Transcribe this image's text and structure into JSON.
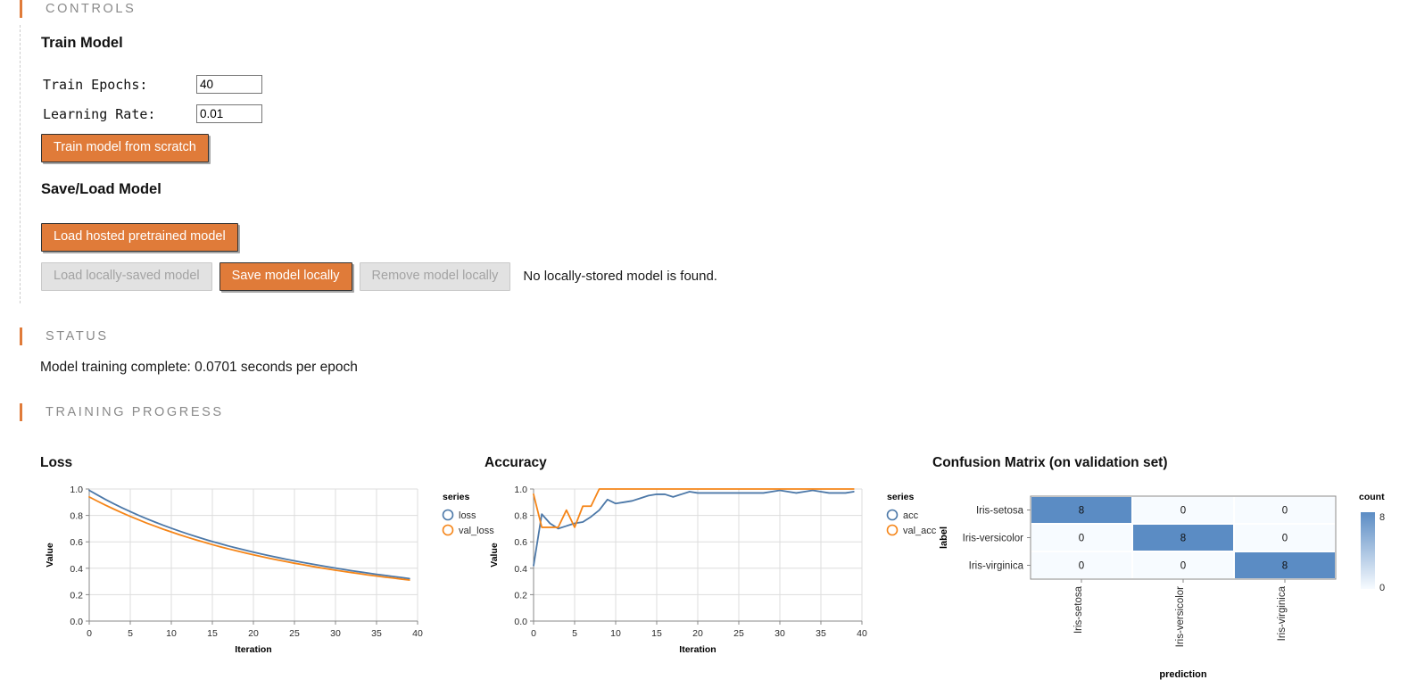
{
  "sections": {
    "controls": "CONTROLS",
    "status": "STATUS",
    "training_progress": "TRAINING PROGRESS"
  },
  "train_model": {
    "heading": "Train Model",
    "epochs_label": "Train Epochs:",
    "epochs_value": "40",
    "lr_label": "Learning Rate:",
    "lr_value": "0.01",
    "train_button": "Train model from scratch"
  },
  "save_load": {
    "heading": "Save/Load Model",
    "load_hosted_button": "Load hosted pretrained model",
    "load_local_button": "Load locally-saved model",
    "save_local_button": "Save model locally",
    "remove_local_button": "Remove model locally",
    "local_status": "No locally-stored model is found."
  },
  "status": {
    "message": "Model training complete: 0.0701 seconds per epoch"
  },
  "colors": {
    "accent_orange": "#e07b39",
    "series_blue": "#4c78a8",
    "series_orange": "#f58518",
    "matrix_blue": "#5b8cc4",
    "matrix_empty": "#f4f8fd"
  },
  "chart_data": [
    {
      "type": "line",
      "title": "Loss",
      "xlabel": "Iteration",
      "ylabel": "Value",
      "xlim": [
        0,
        40
      ],
      "ylim": [
        0.0,
        1.0
      ],
      "xticks": [
        0,
        5,
        10,
        15,
        20,
        25,
        30,
        35,
        40
      ],
      "yticks": [
        "0.0",
        "0.2",
        "0.4",
        "0.6",
        "0.8",
        "1.0"
      ],
      "grid": true,
      "legend_title": "series",
      "legend_position": "right",
      "x": [
        0,
        1,
        2,
        3,
        4,
        5,
        6,
        7,
        8,
        9,
        10,
        11,
        12,
        13,
        14,
        15,
        16,
        17,
        18,
        19,
        20,
        21,
        22,
        23,
        24,
        25,
        26,
        27,
        28,
        29,
        30,
        31,
        32,
        33,
        34,
        35,
        36,
        37,
        38,
        39
      ],
      "series": [
        {
          "name": "loss",
          "color": "#4c78a8",
          "values": [
            0.99,
            0.955,
            0.92,
            0.888,
            0.858,
            0.829,
            0.801,
            0.775,
            0.75,
            0.726,
            0.703,
            0.681,
            0.66,
            0.64,
            0.621,
            0.602,
            0.585,
            0.568,
            0.552,
            0.537,
            0.522,
            0.508,
            0.494,
            0.481,
            0.468,
            0.456,
            0.444,
            0.433,
            0.422,
            0.411,
            0.401,
            0.391,
            0.381,
            0.372,
            0.363,
            0.354,
            0.346,
            0.338,
            0.33,
            0.322
          ]
        },
        {
          "name": "val_loss",
          "color": "#f58518",
          "values": [
            0.94,
            0.908,
            0.877,
            0.848,
            0.82,
            0.793,
            0.767,
            0.742,
            0.719,
            0.696,
            0.675,
            0.654,
            0.634,
            0.615,
            0.597,
            0.579,
            0.562,
            0.546,
            0.531,
            0.516,
            0.502,
            0.488,
            0.475,
            0.462,
            0.45,
            0.438,
            0.427,
            0.416,
            0.405,
            0.395,
            0.385,
            0.376,
            0.367,
            0.358,
            0.349,
            0.341,
            0.333,
            0.326,
            0.318,
            0.311
          ]
        }
      ]
    },
    {
      "type": "line",
      "title": "Accuracy",
      "xlabel": "Iteration",
      "ylabel": "Value",
      "xlim": [
        0,
        40
      ],
      "ylim": [
        0.0,
        1.0
      ],
      "xticks": [
        0,
        5,
        10,
        15,
        20,
        25,
        30,
        35,
        40
      ],
      "yticks": [
        "0.0",
        "0.2",
        "0.4",
        "0.6",
        "0.8",
        "1.0"
      ],
      "grid": true,
      "legend_title": "series",
      "legend_position": "right",
      "x": [
        0,
        1,
        2,
        3,
        4,
        5,
        6,
        7,
        8,
        9,
        10,
        11,
        12,
        13,
        14,
        15,
        16,
        17,
        18,
        19,
        20,
        21,
        22,
        23,
        24,
        25,
        26,
        27,
        28,
        29,
        30,
        31,
        32,
        33,
        34,
        35,
        36,
        37,
        38,
        39
      ],
      "series": [
        {
          "name": "acc",
          "color": "#4c78a8",
          "values": [
            0.42,
            0.81,
            0.74,
            0.7,
            0.72,
            0.74,
            0.75,
            0.79,
            0.84,
            0.92,
            0.89,
            0.9,
            0.91,
            0.93,
            0.95,
            0.96,
            0.96,
            0.94,
            0.96,
            0.98,
            0.97,
            0.97,
            0.97,
            0.97,
            0.97,
            0.97,
            0.97,
            0.97,
            0.97,
            0.98,
            0.99,
            0.98,
            0.97,
            0.98,
            0.99,
            0.98,
            0.97,
            0.97,
            0.97,
            0.98
          ]
        },
        {
          "name": "val_acc",
          "color": "#f58518",
          "values": [
            0.96,
            0.71,
            0.71,
            0.71,
            0.84,
            0.71,
            0.87,
            0.87,
            1.0,
            1.0,
            1.0,
            1.0,
            1.0,
            1.0,
            1.0,
            1.0,
            1.0,
            1.0,
            1.0,
            1.0,
            1.0,
            1.0,
            1.0,
            1.0,
            1.0,
            1.0,
            1.0,
            1.0,
            1.0,
            1.0,
            1.0,
            1.0,
            1.0,
            1.0,
            1.0,
            1.0,
            1.0,
            1.0,
            1.0,
            1.0
          ]
        }
      ]
    },
    {
      "type": "heatmap",
      "title": "Confusion Matrix (on validation set)",
      "xlabel": "prediction",
      "ylabel": "label",
      "legend_title": "count",
      "legend_max": "8",
      "legend_min": "0",
      "row_labels": [
        "Iris-setosa",
        "Iris-versicolor",
        "Iris-virginica"
      ],
      "col_labels": [
        "Iris-setosa",
        "Iris-versicolor",
        "Iris-virginica"
      ],
      "values": [
        [
          8,
          0,
          0
        ],
        [
          0,
          8,
          0
        ],
        [
          0,
          0,
          8
        ]
      ]
    }
  ]
}
